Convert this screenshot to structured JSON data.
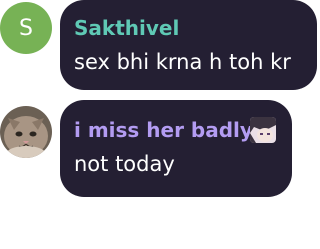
{
  "messages": [
    {
      "avatar_letter": "S",
      "avatar_color": "#77b255",
      "username": "Sakthivel",
      "username_color": "#5fc9b5",
      "text": "sex bhi krna h toh kr"
    },
    {
      "avatar_icon": "cat-photo-avatar",
      "username": "i miss her badly",
      "username_color": "#b39cf2",
      "badge_icon": "anime-character-icon",
      "text": "not today"
    }
  ],
  "colors": {
    "bubble_bg": "#241f33",
    "text": "#ffffff"
  }
}
